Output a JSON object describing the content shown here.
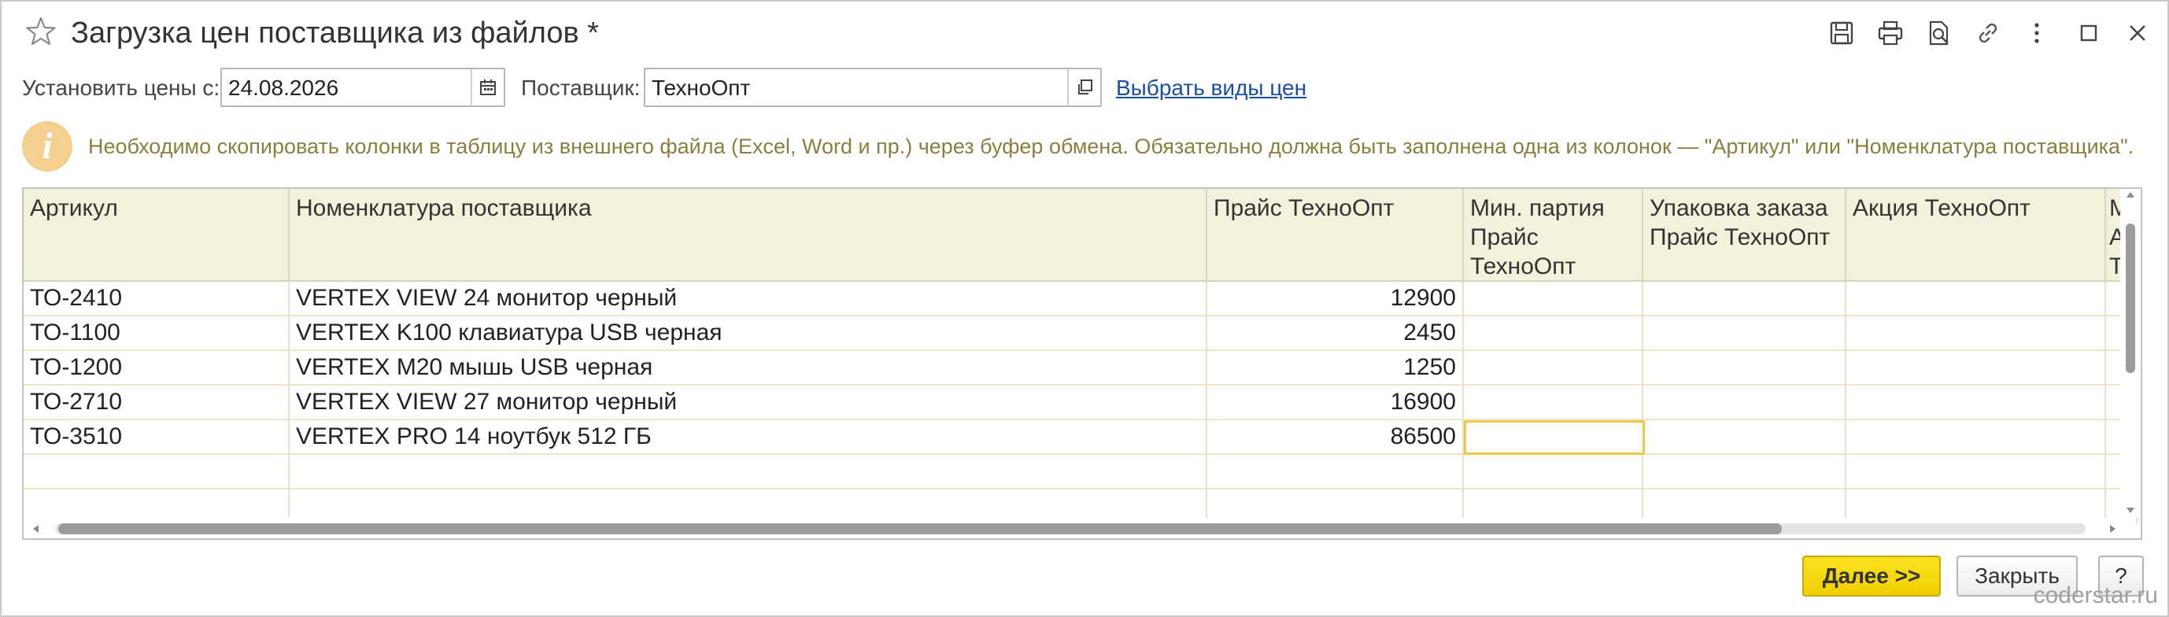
{
  "window": {
    "title": "Загрузка цен поставщика из файлов *",
    "star_icon": "star-outline-icon"
  },
  "toolbar": {
    "icons": [
      "save-icon",
      "print-icon",
      "preview-icon",
      "link-icon",
      "more-icon",
      "maximize-icon",
      "close-icon"
    ]
  },
  "params": {
    "date_label": "Установить цены с:",
    "date_value": "24.08.2026",
    "supplier_label": "Поставщик:",
    "supplier_value": "ТехноОпт",
    "price_types_link": "Выбрать виды цен"
  },
  "info": {
    "icon_letter": "i",
    "text": "Необходимо скопировать колонки в таблицу из внешнего файла (Excel, Word и пр.) через буфер обмена. Обязательно должна быть заполнена одна из колонок — \"Артикул\" или \"Номенклатура поставщика\"."
  },
  "table": {
    "columns": [
      "Артикул",
      "Номенклатура поставщика",
      "Прайс ТехноОпт",
      "Мин. партия Прайс ТехноОпт",
      "Упаковка заказа Прайс ТехноОпт",
      "Акция ТехноОпт",
      "М А Т"
    ],
    "rows": [
      [
        "ТО-2410",
        "VERTEX VIEW 24 монитор черный",
        "12900",
        "",
        "",
        "",
        ""
      ],
      [
        "ТО-1100",
        "VERTEX K100 клавиатура USB черная",
        "2450",
        "",
        "",
        "",
        ""
      ],
      [
        "ТО-1200",
        "VERTEX M20 мышь USB черная",
        "1250",
        "",
        "",
        "",
        ""
      ],
      [
        "ТО-2710",
        "VERTEX VIEW 27 монитор черный",
        "16900",
        "",
        "",
        "",
        ""
      ],
      [
        "ТО-3510",
        "VERTEX PRO 14 ноутбук 512 ГБ",
        "86500",
        "",
        "",
        "",
        ""
      ]
    ]
  },
  "buttons": {
    "next": "Далее >>",
    "close": "Закрыть",
    "help": "?"
  },
  "watermark": "coderstar.ru",
  "colors": {
    "header_bg": "#f3f1dc",
    "primary_button": "#f5d800",
    "link": "#1a4fa3",
    "info_text": "#8a7f3f",
    "info_icon": "#f5cf8e",
    "active_cell_border": "#f0c94a"
  }
}
